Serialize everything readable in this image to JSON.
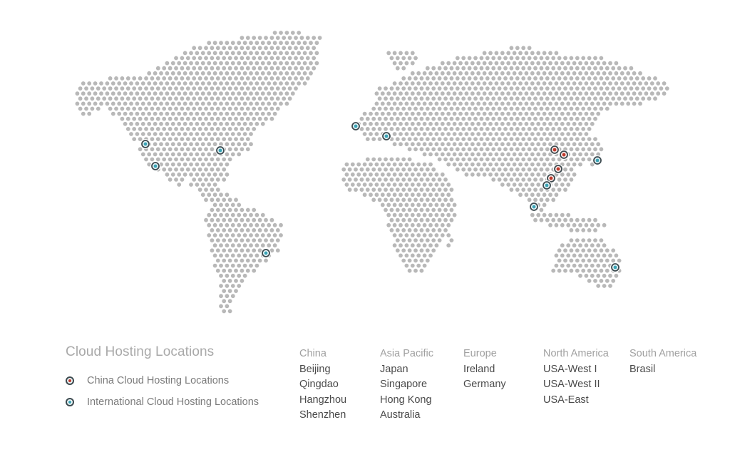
{
  "title": "Cloud Hosting Locations",
  "legend": [
    {
      "label": "China Cloud Hosting Locations",
      "type": "china",
      "color": "#c0392b"
    },
    {
      "label": "International Cloud Hosting Locations",
      "type": "international",
      "color": "#3aa3b5"
    }
  ],
  "colors": {
    "land_dot": "#b8b8b8",
    "marker_ring": "#3d4a4f",
    "china": "#c0392b",
    "international": "#3aa3b5"
  },
  "regions": [
    {
      "name": "China",
      "cities": [
        "Beijing",
        "Qingdao",
        "Hangzhou",
        "Shenzhen"
      ]
    },
    {
      "name": "Asia Pacific",
      "cities": [
        "Japan",
        "Singapore",
        "Hong Kong",
        "Australia"
      ]
    },
    {
      "name": "Europe",
      "cities": [
        "Ireland",
        "Germany"
      ]
    },
    {
      "name": "North America",
      "cities": [
        "USA-West I",
        "USA-West II",
        "USA-East"
      ]
    },
    {
      "name": "South America",
      "cities": [
        "Brasil"
      ]
    }
  ],
  "markers": [
    {
      "name": "USA-West I",
      "type": "international"
    },
    {
      "name": "USA-West II",
      "type": "international"
    },
    {
      "name": "USA-East",
      "type": "international"
    },
    {
      "name": "Brasil",
      "type": "international"
    },
    {
      "name": "Ireland",
      "type": "international"
    },
    {
      "name": "Germany",
      "type": "international"
    },
    {
      "name": "Beijing",
      "type": "china"
    },
    {
      "name": "Qingdao",
      "type": "china"
    },
    {
      "name": "Hangzhou",
      "type": "china"
    },
    {
      "name": "Shenzhen",
      "type": "china"
    },
    {
      "name": "Hong Kong",
      "type": "international"
    },
    {
      "name": "Japan",
      "type": "international"
    },
    {
      "name": "Singapore",
      "type": "international"
    },
    {
      "name": "Australia",
      "type": "international"
    }
  ]
}
